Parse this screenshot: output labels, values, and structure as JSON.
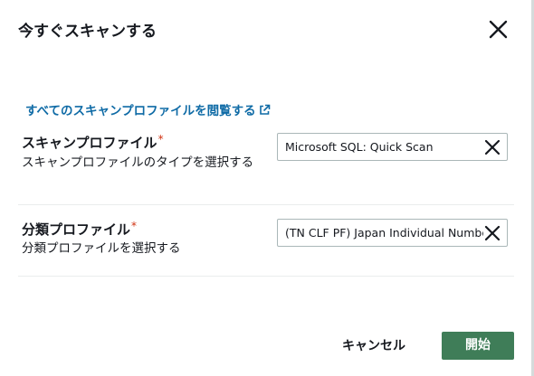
{
  "dialog": {
    "title": "今すぐスキャンする",
    "close_icon": "close-icon"
  },
  "link": {
    "label": "すべてのスキャンプロファイルを閲覧する",
    "icon": "external-link-icon",
    "color": "#0f6ba6"
  },
  "fields": [
    {
      "label": "スキャンプロファイル",
      "required_mark": "*",
      "description": "スキャンプロファイルのタイプを選択する",
      "value": "Microsoft SQL: Quick Scan",
      "clear_icon": "clear-icon"
    },
    {
      "label": "分類プロファイル",
      "required_mark": "*",
      "description": "分類プロファイルを選択する",
      "value": "(TN CLF PF) Japan Individual Number",
      "clear_icon": "clear-icon"
    }
  ],
  "footer": {
    "cancel_label": "キャンセル",
    "start_label": "開始"
  },
  "colors": {
    "primary_button": "#3f7d58",
    "required": "#d13212"
  }
}
